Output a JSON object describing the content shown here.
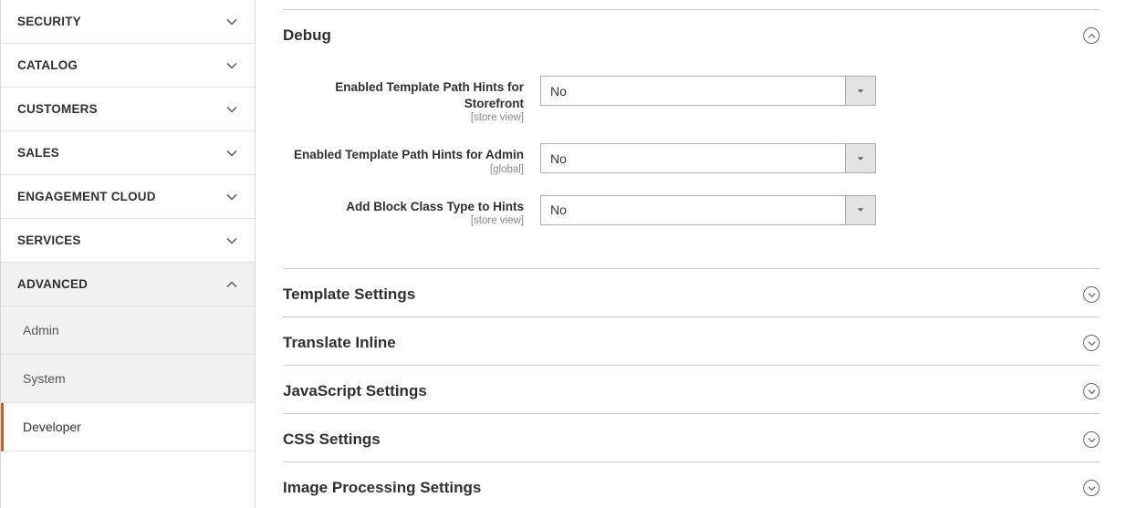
{
  "sidebar": {
    "items": [
      {
        "label": "SECURITY",
        "expanded": false
      },
      {
        "label": "CATALOG",
        "expanded": false
      },
      {
        "label": "CUSTOMERS",
        "expanded": false
      },
      {
        "label": "SALES",
        "expanded": false
      },
      {
        "label": "ENGAGEMENT CLOUD",
        "expanded": false
      },
      {
        "label": "SERVICES",
        "expanded": false
      },
      {
        "label": "ADVANCED",
        "expanded": true
      }
    ],
    "advanced_children": [
      {
        "label": "Admin",
        "active": false
      },
      {
        "label": "System",
        "active": false
      },
      {
        "label": "Developer",
        "active": true
      }
    ]
  },
  "main": {
    "debug": {
      "title": "Debug",
      "expanded": true,
      "fields": [
        {
          "label": "Enabled Template Path Hints for Storefront",
          "scope": "[store view]",
          "value": "No"
        },
        {
          "label": "Enabled Template Path Hints for Admin",
          "scope": "[global]",
          "value": "No"
        },
        {
          "label": "Add Block Class Type to Hints",
          "scope": "[store view]",
          "value": "No"
        }
      ]
    },
    "collapsed_sections": [
      {
        "title": "Template Settings"
      },
      {
        "title": "Translate Inline"
      },
      {
        "title": "JavaScript Settings"
      },
      {
        "title": "CSS Settings"
      },
      {
        "title": "Image Processing Settings"
      }
    ]
  }
}
